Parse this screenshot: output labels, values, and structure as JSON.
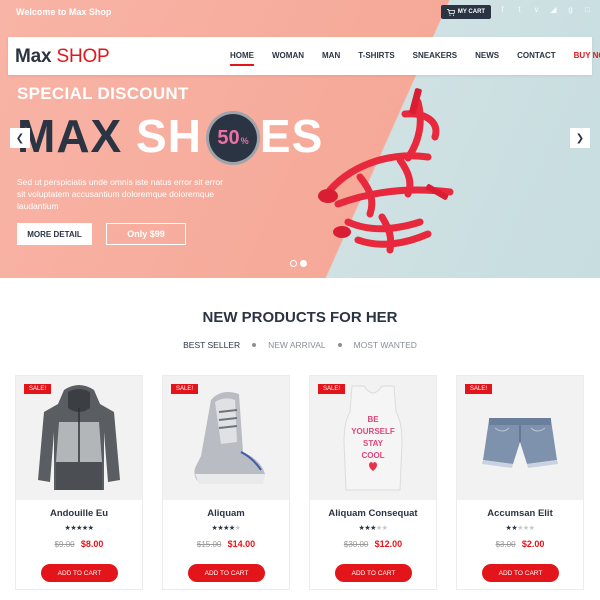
{
  "topbar": {
    "welcome": "Welcome to Max Shop",
    "cart_label": "MY CART",
    "socials": [
      {
        "icon": "facebook-icon",
        "glyph": "f"
      },
      {
        "icon": "twitter-icon",
        "glyph": "t"
      },
      {
        "icon": "vimeo-icon",
        "glyph": "v"
      },
      {
        "icon": "rss-icon",
        "glyph": "◢"
      },
      {
        "icon": "google-plus-icon",
        "glyph": "g"
      },
      {
        "icon": "instagram-icon",
        "glyph": "□"
      }
    ]
  },
  "logo": {
    "max": "Max",
    "shop": "SHOP"
  },
  "nav": {
    "items": [
      "HOME",
      "WOMAN",
      "MAN",
      "T-SHIRTS",
      "SNEAKERS",
      "NEWS",
      "CONTACT",
      "BUY NOW"
    ],
    "active": "HOME"
  },
  "hero": {
    "subtitle": "SPECIAL DISCOUNT",
    "title_dark": "MAX",
    "title_light": "SH",
    "title_light_end": "ES",
    "badge_value": "50",
    "badge_pct": "%",
    "description": "Sed ut perspiciatis unde omnis iste natus error sit error sit voluptatem accusantium doloremque doloremque laudantium",
    "btn_detail": "MORE DETAIL",
    "btn_price": "Only $99",
    "slide_count": 2,
    "active_slide": 2
  },
  "products": {
    "title": "NEW PRODUCTS FOR HER",
    "filters": [
      "BEST SELLER",
      "NEW ARRIVAL",
      "MOST WANTED"
    ],
    "active_filter": "BEST SELLER",
    "sale_label": "SALE!",
    "add_label": "ADD TO CART",
    "items": [
      {
        "name": "Andouille Eu",
        "rating": 5,
        "old_price": "$9.00",
        "price": "$8.00",
        "image": "hoodie"
      },
      {
        "name": "Aliquam",
        "rating": 4,
        "old_price": "$15.00",
        "price": "$14.00",
        "image": "sneaker"
      },
      {
        "name": "Aliquam Consequat",
        "rating": 3,
        "old_price": "$30.00",
        "price": "$12.00",
        "image": "tank-top",
        "tank_text": [
          "BE",
          "YOURSELF",
          "STAY",
          "COOL"
        ]
      },
      {
        "name": "Accumsan Elit",
        "rating": 2,
        "old_price": "$3.00",
        "price": "$2.00",
        "image": "denim-shorts"
      }
    ]
  },
  "colors": {
    "accent": "#e3151a",
    "navy": "#2b3443",
    "hero_pink": "#f6a998",
    "hero_blue": "#c7dde0",
    "badge_pink": "#f06fa4"
  }
}
